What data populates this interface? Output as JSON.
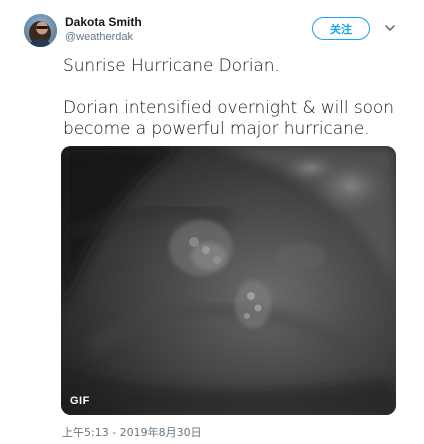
{
  "author": {
    "name": "Dakota Smith",
    "handle": "@weatherdak"
  },
  "follow_button": {
    "label": "关注",
    "color": "#1da1f2"
  },
  "more_menu": {
    "icon": "chevron-down-icon"
  },
  "tweet": {
    "line1": "Sunrise Hurricane Dorian.",
    "line2": "Dorian intensified overnight & will soon",
    "line3": "become a powerful major hurricane."
  },
  "media": {
    "type": "gif",
    "badge": "GIF",
    "description_icon": "hurricane-satellite-image"
  },
  "timestamp": "上午5:13 - 2019年8月30日",
  "colors": {
    "accent": "#1da1f2",
    "secondary_text": "#657786",
    "primary_text": "#14171a"
  }
}
